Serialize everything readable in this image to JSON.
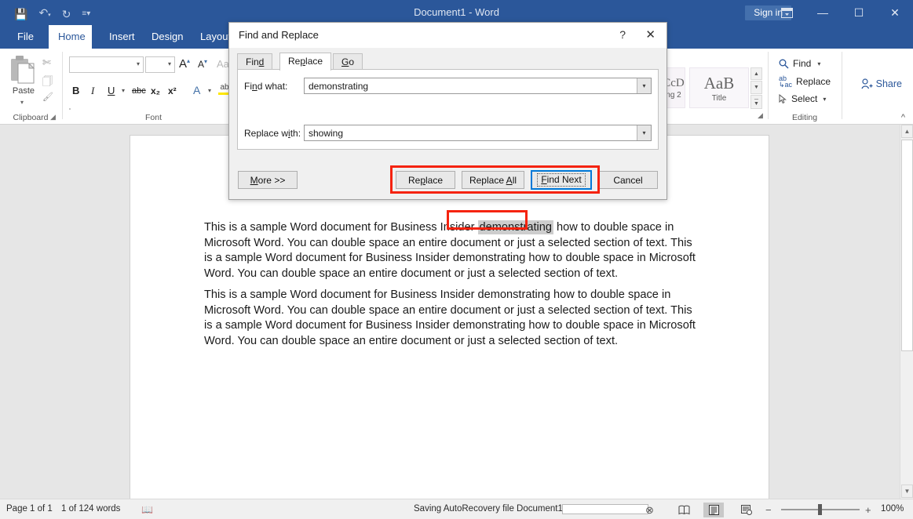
{
  "titlebar": {
    "title": "Document1  -  Word",
    "signin": "Sign in",
    "qat": {
      "save": "save-icon",
      "undo": "undo-icon",
      "redo": "redo-icon",
      "customize": "customize-qat-icon"
    },
    "ribbon_display_options": "ribbon-display-options-icon",
    "minimize": "—",
    "maximize": "☐",
    "close": "✕"
  },
  "ribbon": {
    "tabs": [
      {
        "label": "File",
        "active": false
      },
      {
        "label": "Home",
        "active": true
      },
      {
        "label": "Insert",
        "active": false
      },
      {
        "label": "Design",
        "active": false
      },
      {
        "label": "Layout",
        "active": false
      }
    ],
    "share": "Share",
    "groups": {
      "clipboard": {
        "label": "Clipboard",
        "paste": "Paste",
        "cut": "cut-icon",
        "copy": "copy-icon",
        "format_painter": "format-painter-icon"
      },
      "font": {
        "label": "Font",
        "font_family_value": "",
        "font_size_value": "",
        "grow_font": "A",
        "shrink_font": "A",
        "change_case": "Aa",
        "bold": "B",
        "italic": "I",
        "underline": "U",
        "strikethrough": "abc",
        "subscript": "x₂",
        "superscript": "x²",
        "text_color": "A",
        "text_highlight": "ab"
      },
      "styles": {
        "partial_left_top": "CcD",
        "partial_left_bottom": "ng 2",
        "title_preview": "AaB",
        "title_name": "Title"
      },
      "editing": {
        "label": "Editing",
        "find": "Find",
        "replace": "Replace",
        "select": "Select"
      }
    }
  },
  "document": {
    "paragraph_1_before": "This is a sample Word document for Business Insider ",
    "paragraph_1_highlight": "demonstrating",
    "paragraph_1_after": " how to double space in Microsoft Word. You can double space an entire document or just a selected section of text. This is a sample Word document for Business Insider demonstrating how to double space in Microsoft Word. You can double space an entire document or just a selected section of text.",
    "paragraph_2": "This is a sample Word document for Business Insider demonstrating how to double space in Microsoft Word. You can double space an entire document or just a selected section of text. This is a sample Word document for Business Insider demonstrating how to double space in Microsoft Word. You can double space an entire document or just a selected section of text."
  },
  "dialog": {
    "title": "Find and Replace",
    "help": "?",
    "close": "✕",
    "tabs": [
      {
        "label": "Find",
        "active": false
      },
      {
        "label": "Replace",
        "active": true
      },
      {
        "label": "Go To",
        "active": false
      }
    ],
    "find_what_label": "Find what:",
    "find_what_value": "demonstrating",
    "replace_with_label": "Replace with:",
    "replace_with_value": "showing",
    "buttons": {
      "more": "More >>",
      "replace": "Replace",
      "replace_all": "Replace All",
      "find_next": "Find Next",
      "cancel": "Cancel"
    }
  },
  "statusbar": {
    "page": "Page 1 of 1",
    "words": "1 of 124 words",
    "proofing": "proofing-icon",
    "autorecovery": "Saving AutoRecovery file Document1:",
    "cancel_save": "⊗",
    "views": {
      "read_mode": "read-mode-icon",
      "print_layout": "print-layout-icon",
      "web_layout": "web-layout-icon"
    },
    "zoom_out": "−",
    "zoom_in": "+",
    "zoom_level": "100%"
  },
  "colors": {
    "word_blue": "#2b579a",
    "highlight_red": "#f5230f",
    "focus_blue": "#0078d7",
    "selection_gray": "#cdcdcd"
  }
}
